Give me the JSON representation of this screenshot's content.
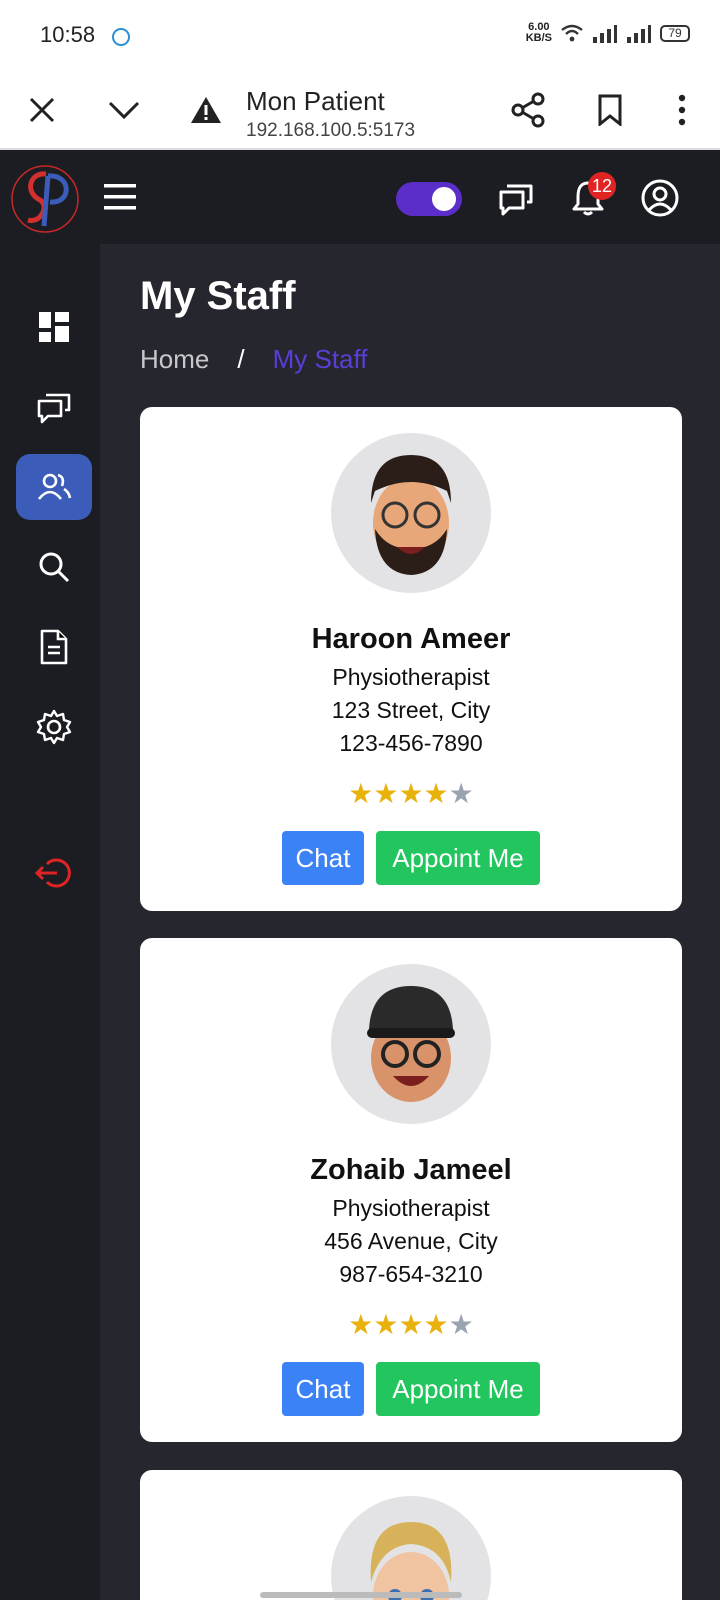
{
  "status_bar": {
    "time": "10:58",
    "speed_value": "6.00",
    "speed_unit": "KB/S",
    "battery": "79"
  },
  "browser": {
    "title": "Mon Patient",
    "url": "192.168.100.5:5173"
  },
  "header": {
    "notification_count": "12",
    "theme_toggle_on": true
  },
  "sidebar": {
    "items": [
      {
        "name": "dashboard",
        "icon": "dashboard-icon"
      },
      {
        "name": "chat",
        "icon": "chat-icon"
      },
      {
        "name": "staff",
        "icon": "users-icon",
        "active": true
      },
      {
        "name": "search",
        "icon": "search-icon"
      },
      {
        "name": "documents",
        "icon": "document-icon"
      },
      {
        "name": "settings",
        "icon": "gear-icon"
      },
      {
        "name": "logout",
        "icon": "logout-icon"
      }
    ]
  },
  "page": {
    "title": "My Staff",
    "breadcrumb": {
      "home": "Home",
      "separator": "/",
      "current": "My Staff"
    }
  },
  "staff": [
    {
      "name": "Haroon Ameer",
      "role": "Physiotherapist",
      "address": "123 Street, City",
      "phone": "123-456-7890",
      "rating": 4,
      "rating_max": 5,
      "chat_label": "Chat",
      "appoint_label": "Appoint Me"
    },
    {
      "name": "Zohaib Jameel",
      "role": "Physiotherapist",
      "address": "456 Avenue, City",
      "phone": "987-654-3210",
      "rating": 4,
      "rating_max": 5,
      "chat_label": "Chat",
      "appoint_label": "Appoint Me"
    }
  ],
  "colors": {
    "accent": "#5b2ec9",
    "active_nav": "#3b5cb8",
    "chat_button": "#3b82f6",
    "appoint_button": "#22c55e",
    "star": "#e8b10c",
    "logout": "#e02424"
  }
}
